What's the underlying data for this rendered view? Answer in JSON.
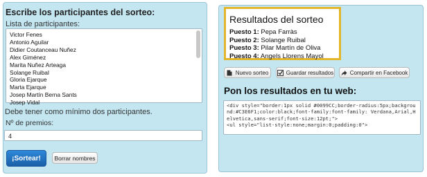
{
  "left_panel": {
    "title": "Escribe los participantes del sorteo:",
    "list_label": "Lista de participantes:",
    "participants": [
      "Victor Fenes",
      "Antonio Aguilar",
      "Didier Coutanceau Nuñez",
      "Alex Giménez",
      "Marita Nuñez Arteaga",
      "Solange Ruibal",
      "Gloria Ejarque",
      "Marta Ejarque",
      "Josep Martín Berna Sants",
      "Josep Vidal"
    ],
    "min_note": "Debe tener como mínimo dos participantes.",
    "num_prizes_label": "Nº de premios:",
    "num_prizes_value": "4",
    "sortear_label": "¡Sortear!",
    "clear_label": "Borrar nombres"
  },
  "right_panel": {
    "results_title": "Resultados del sorteo",
    "results": [
      {
        "label": "Puesto 1:",
        "name": "Pepa Farràs"
      },
      {
        "label": "Puesto 2:",
        "name": "Solange Ruibal"
      },
      {
        "label": "Puesto 3:",
        "name": "Pilar Martín de Oliva"
      },
      {
        "label": "Puesto 4:",
        "name": "Angels Llorens Mayol"
      }
    ],
    "buttons": {
      "new_draw": "Nuevo sorteo",
      "save_results": "Guardar resultados",
      "share_facebook": "Compartir en Facebook"
    },
    "web_title": "Pon los resultados en tu web:",
    "embed_code": "<div style=\"border:1px solid #0099CC;border-radius:5px;background:#C3E6F1;color:black;font-family:font-family: Verdana,Arial,Helvetica,sans-serif;font-size:12pt;\">\n<ul style=\"list-style:none;margin:0;padding:0\">"
  },
  "icons": {
    "new_draw": "document-icon",
    "save_results": "check-icon",
    "share_facebook": "share-arrow-icon"
  },
  "colors": {
    "panel_bg": "#C3E6F1",
    "results_border": "#E2B52B",
    "primary_button": "#1A5FA8"
  }
}
